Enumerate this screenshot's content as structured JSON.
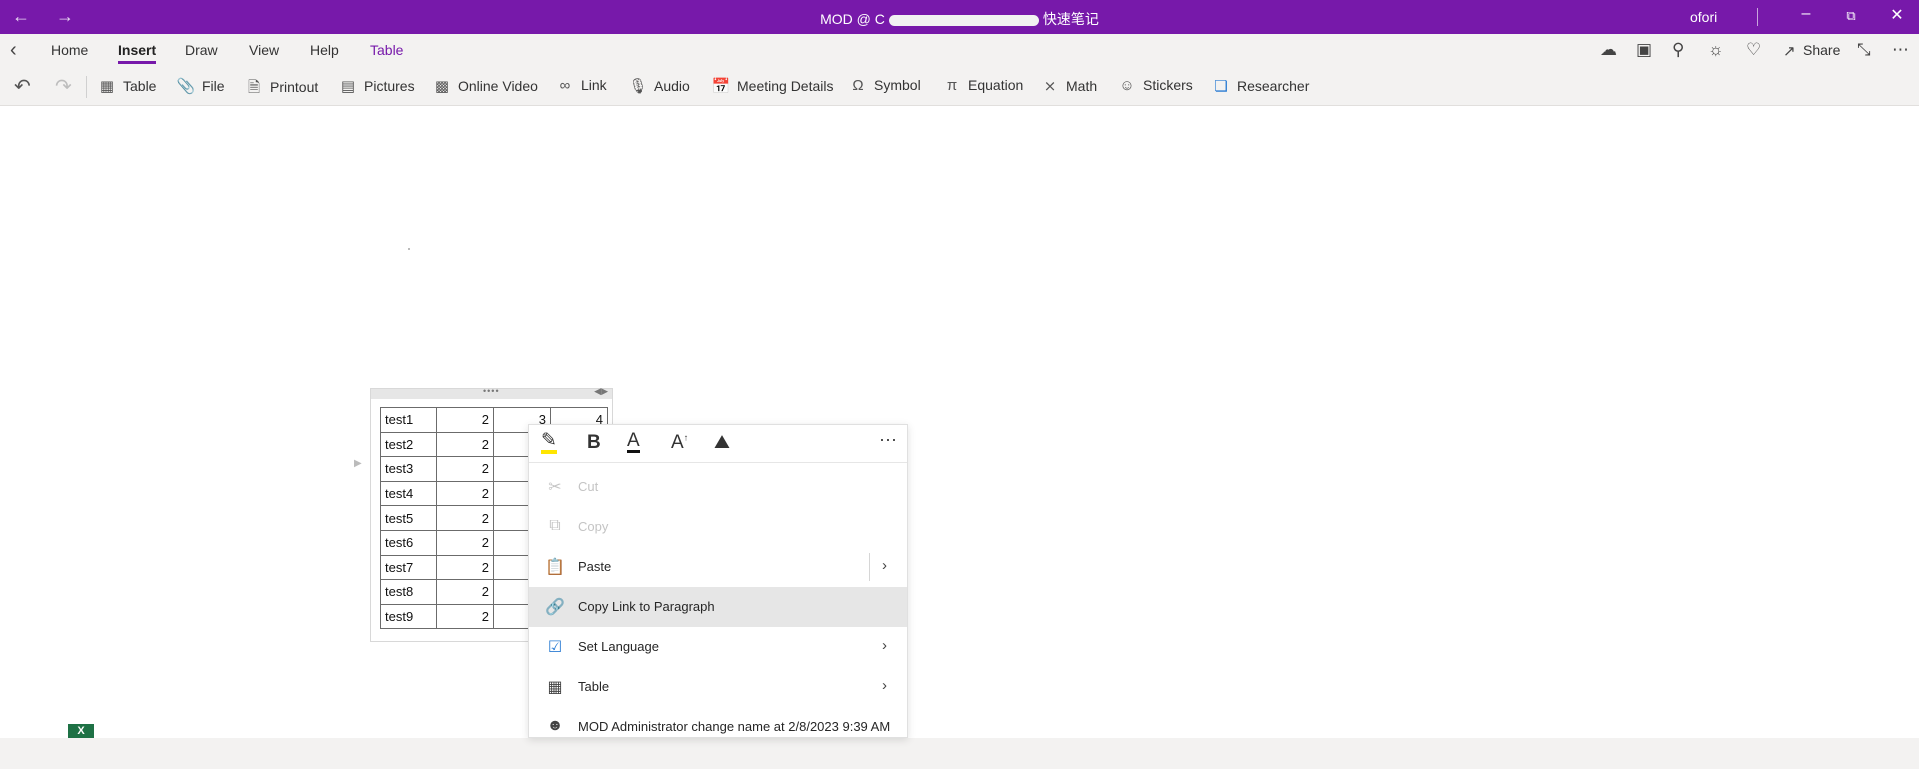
{
  "titlebar": {
    "back_icon": "arrow-left-icon",
    "forward_icon": "arrow-right-icon",
    "title_prefix": "MOD @ C",
    "title_suffix": "快速笔记",
    "user": "ofori"
  },
  "menubar": {
    "tabs": [
      "Home",
      "Insert",
      "Draw",
      "View",
      "Help",
      "Table"
    ],
    "share_label": "Share"
  },
  "ribbon": {
    "items": [
      "Table",
      "File",
      "Printout",
      "Pictures",
      "Online Video",
      "Link",
      "Audio",
      "Meeting Details",
      "Symbol",
      "Equation",
      "Math",
      "Stickers",
      "Researcher"
    ]
  },
  "note_table": {
    "rows": [
      [
        "test1",
        "2",
        "3",
        "4"
      ],
      [
        "test2",
        "2",
        "",
        ""
      ],
      [
        "test3",
        "2",
        "",
        ""
      ],
      [
        "test4",
        "2",
        "",
        ""
      ],
      [
        "test5",
        "2",
        "",
        ""
      ],
      [
        "test6",
        "2",
        "",
        ""
      ],
      [
        "test7",
        "2",
        "",
        ""
      ],
      [
        "test8",
        "2",
        "",
        ""
      ],
      [
        "test9",
        "2",
        "",
        ""
      ]
    ]
  },
  "context_menu": {
    "mini_toolbar": {
      "bold": "B",
      "font_color": "A",
      "font_size": "A",
      "more": "···"
    },
    "items": {
      "cut": "Cut",
      "copy": "Copy",
      "paste": "Paste",
      "copy_link": "Copy Link to Paragraph",
      "set_language": "Set Language",
      "table": "Table",
      "author": "MOD Administrator change name at 2/8/2023 9:39 AM"
    }
  },
  "colors": {
    "accent": "#7719aa",
    "highlight": "#ffe600"
  }
}
